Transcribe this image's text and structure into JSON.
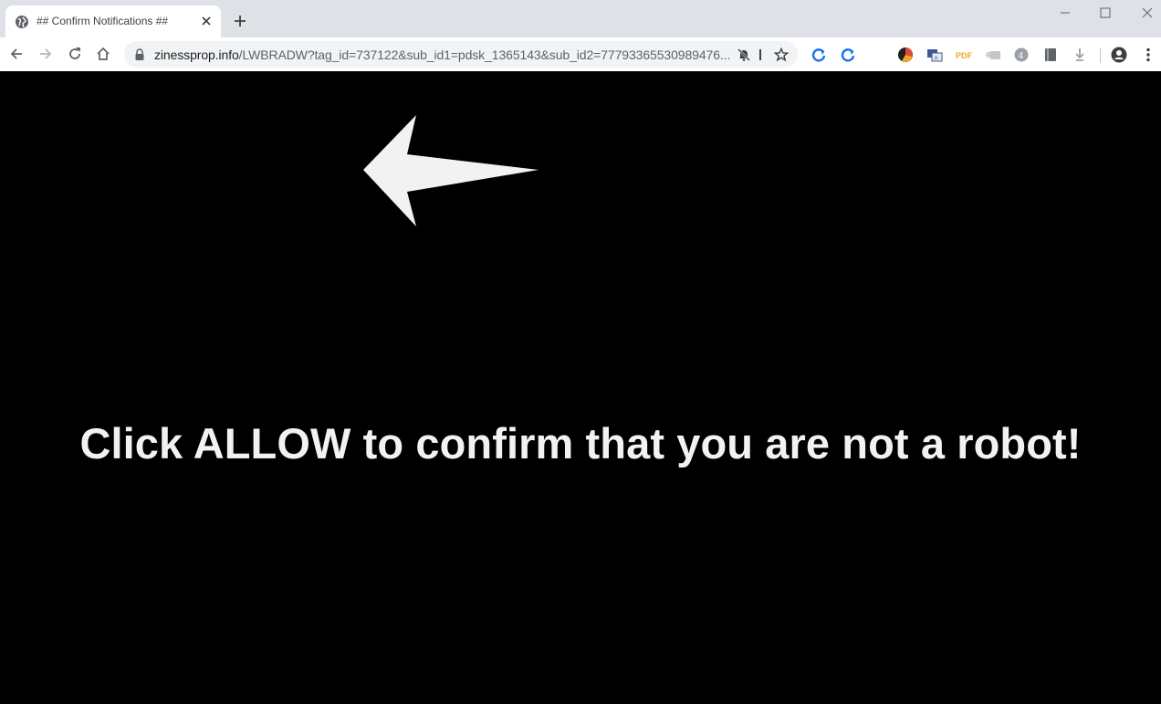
{
  "browser": {
    "tab": {
      "title": "## Confirm Notifications ##"
    },
    "address_bar": {
      "host": "zinessprop.info",
      "path": "/LWBRADW?tag_id=737122&sub_id1=pdsk_1365143&sub_id2=77793365530989476..."
    },
    "extension_icons": [
      "sync-icon",
      "sync-icon",
      "color-picker-icon",
      "translate-icon",
      "pdf-icon",
      "screenshot-icon",
      "counter-icon",
      "notes-icon",
      "download-icon"
    ]
  },
  "page": {
    "headline": "Click ALLOW to confirm that you are not a robot!"
  },
  "colors": {
    "page_background": "#000000",
    "headline": "#f2f2f2",
    "arrow": "#f2f2f2",
    "tabstrip": "#dee1e6",
    "omnibox": "#f1f3f4",
    "sync_accent": "#1a73e8"
  }
}
